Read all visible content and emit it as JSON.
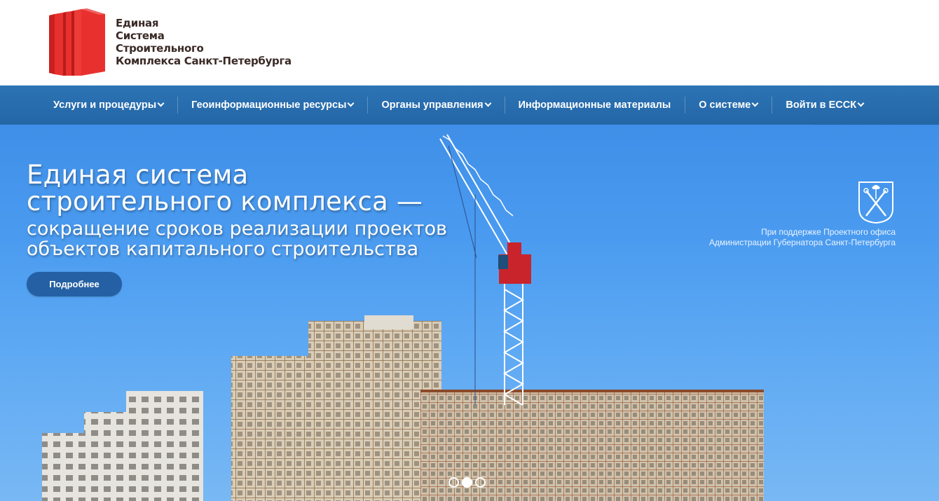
{
  "logo": {
    "lines": [
      "Единая",
      "Система",
      "Строительного",
      "Комплекса Санкт-Петербурга"
    ],
    "color": "#e8312e",
    "text_color": "#3a2a26"
  },
  "nav": {
    "background": "#2c74b5",
    "items": [
      {
        "label": "Услуги и процедуры",
        "dropdown": true
      },
      {
        "label": "Геоинформационные ресурсы",
        "dropdown": true
      },
      {
        "label": "Органы управления",
        "dropdown": true
      },
      {
        "label": "Информационные материалы",
        "dropdown": false
      },
      {
        "label": "О системе",
        "dropdown": true
      },
      {
        "label": "Войти в ЕССК",
        "dropdown": true
      }
    ]
  },
  "hero": {
    "title_lines": [
      "Единая система",
      "строительного комплекса —"
    ],
    "subtitle_lines": [
      "сокращение сроков реализации проектов",
      "объектов капитального строительства"
    ],
    "button_label": "Подробнее",
    "support_lines": [
      "При поддержке Проектного офиса",
      "Администрации Губернатора Санкт-Петербурга"
    ],
    "emblem_icon": "spb-coat-of-arms-icon",
    "slides": 3,
    "active_slide": 2
  }
}
